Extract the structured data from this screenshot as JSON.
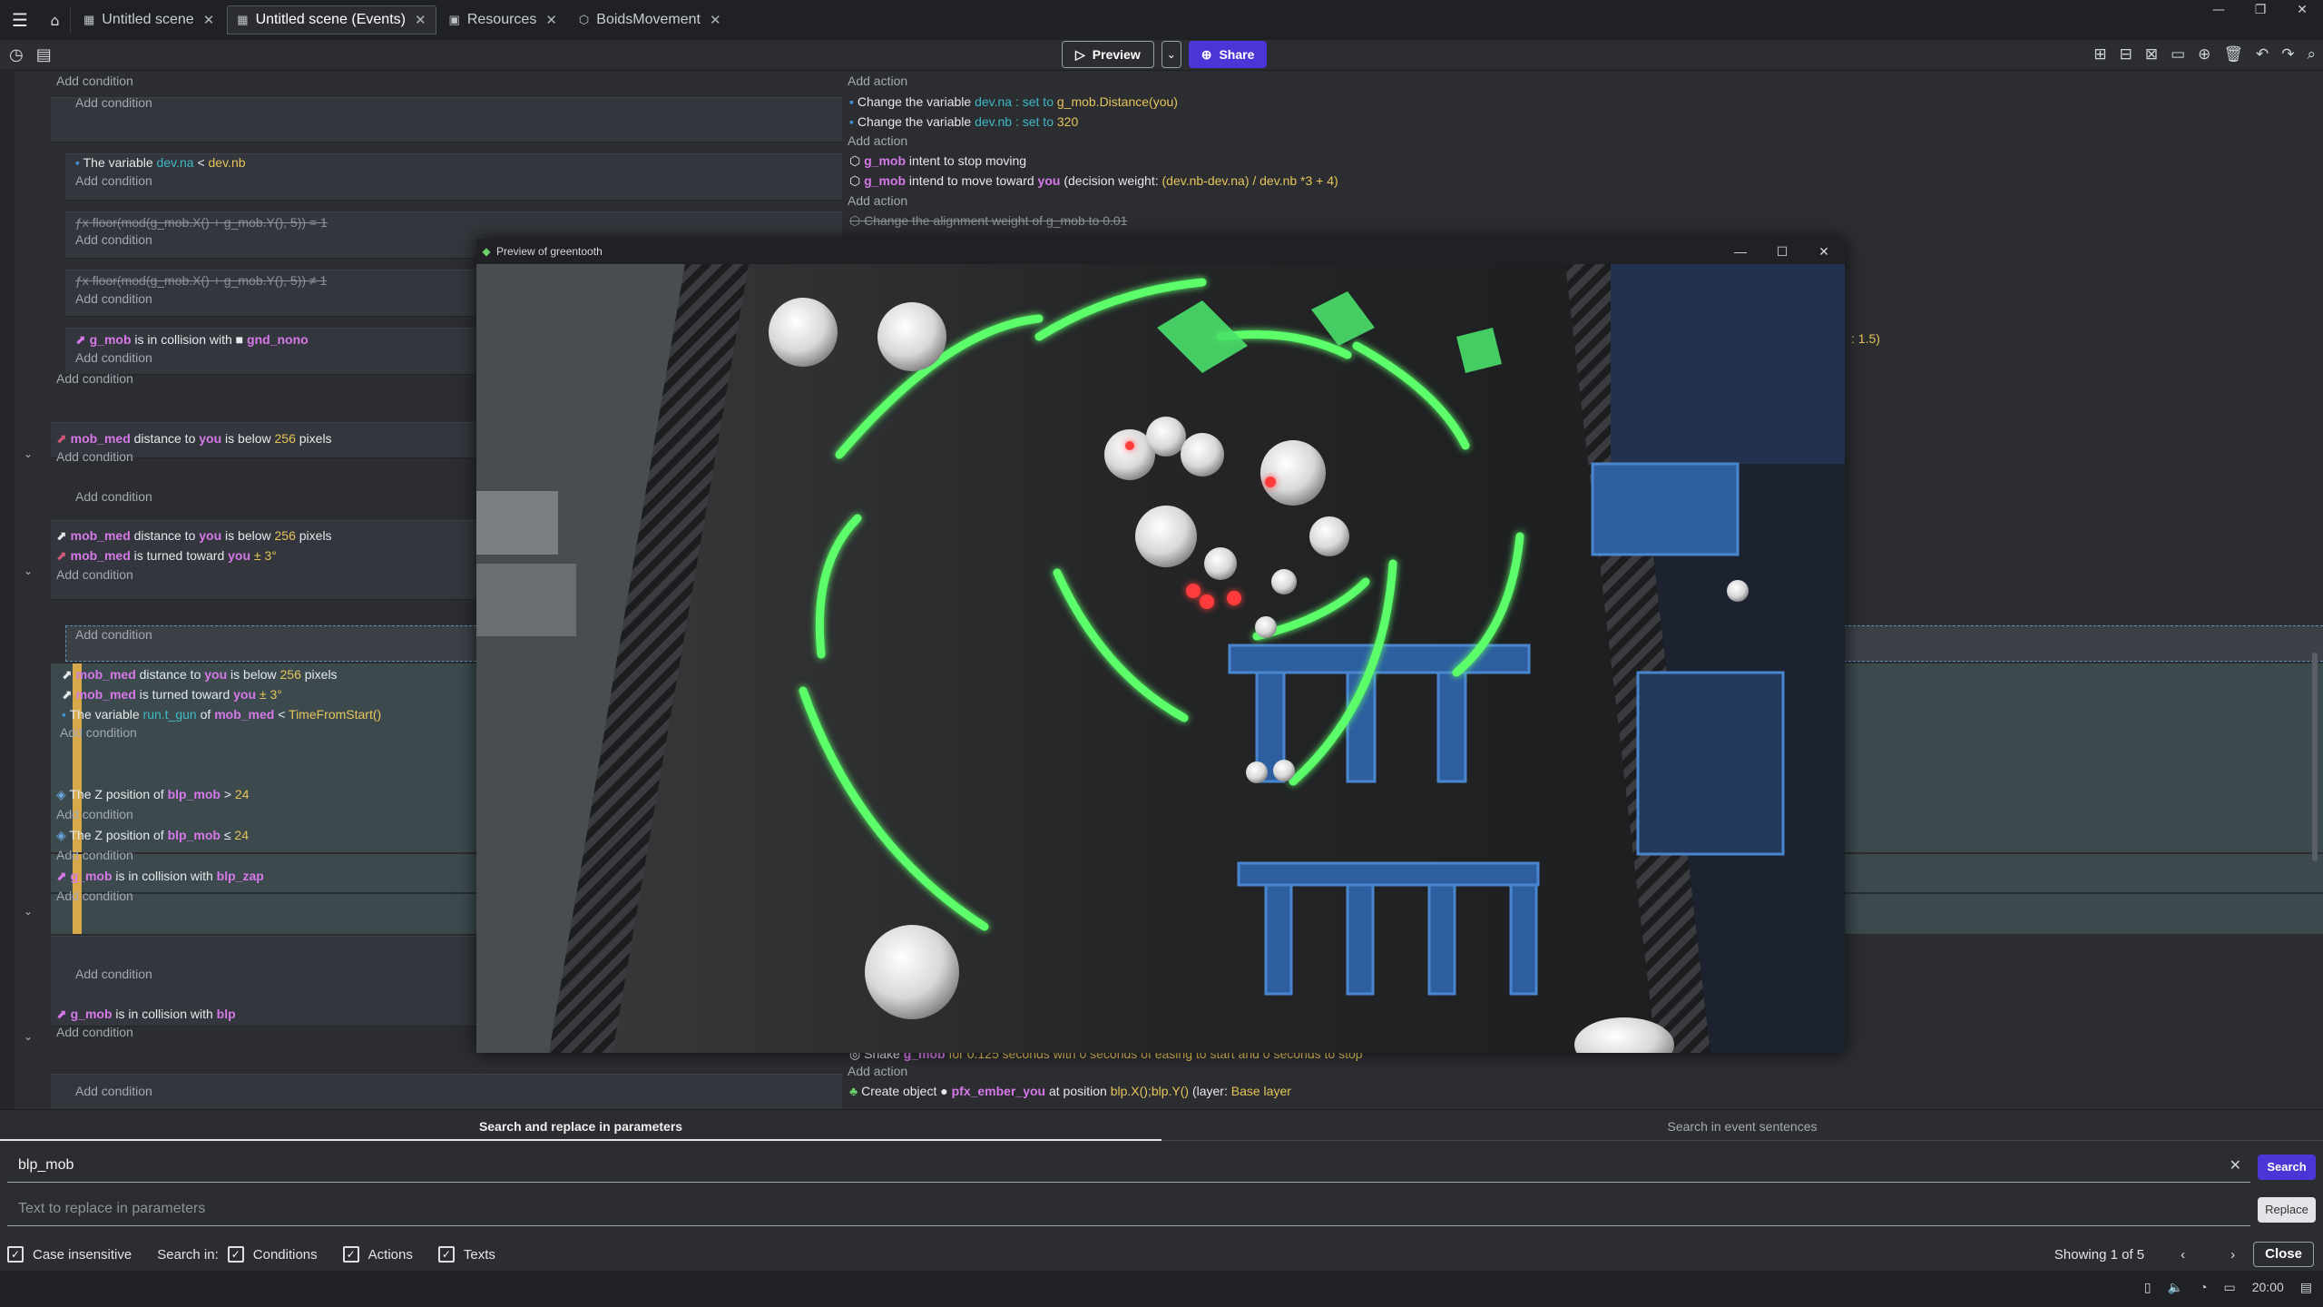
{
  "tabs": [
    {
      "label": "Untitled scene",
      "icon": "▦"
    },
    {
      "label": "Untitled scene (Events)",
      "icon": "▦"
    },
    {
      "label": "Resources",
      "icon": "▣"
    },
    {
      "label": "BoidsMovement",
      "icon": "⬡"
    }
  ],
  "toolbar": {
    "preview_label": "Preview",
    "share_label": "Share"
  },
  "events": {
    "add_condition": "Add condition",
    "add_action": "Add action",
    "actions_top": {
      "set_dev_na_prefix": "Change the variable",
      "set_dev_na_var": "dev.na",
      "set_dev_na_mid": ": set to",
      "set_dev_na_val": "g_mob.Distance(you)",
      "set_dev_nb_prefix": "Change the variable",
      "set_dev_nb_var": "dev.nb",
      "set_dev_nb_mid": ": set to",
      "set_dev_nb_val": "320",
      "stop_obj": "g_mob",
      "stop_text": "intent to stop moving",
      "move_obj": "g_mob",
      "move_text": "intend to move toward",
      "move_target": "you",
      "move_weight_label": "(decision weight:",
      "move_weight_val": "(dev.nb-dev.na) / dev.nb *3 + 4)",
      "align_text": "Change the alignment weight of",
      "align_obj": "g_mob",
      "align_to": "to",
      "align_val": "0.01",
      "partial_right": ": 1.5)"
    },
    "conditions": {
      "var_na_text": "The variable",
      "var_na_var": "dev.na",
      "var_na_op": "<",
      "var_na_val": "dev.nb",
      "floor1": "floor(mod(g_mob.X() + g_mob.Y(), 5)) = 1",
      "floor2": "floor(mod(g_mob.X() + g_mob.Y(), 5)) ≠ 1",
      "coll_nono_obj": "g_mob",
      "coll_nono_text": "is in collision with",
      "coll_nono_target": "gnd_nono",
      "dist1_obj": "mob_med",
      "dist1_text": "distance to",
      "dist1_target": "you",
      "dist1_below": "is below",
      "dist1_val": "256",
      "dist1_unit": "pixels",
      "dist2_obj": "mob_med",
      "dist2_text": "distance to",
      "dist2_target": "you",
      "dist2_below": "is below",
      "dist2_val": "256",
      "dist2_unit": "pixels",
      "turn2_obj": "mob_med",
      "turn2_text": "is turned toward",
      "turn2_target": "you",
      "turn2_val": "± 3°",
      "dist3_obj": "mob_med",
      "dist3_text": "distance to",
      "dist3_target": "you",
      "dist3_below": "is below",
      "dist3_val": "256",
      "dist3_unit": "pixels",
      "turn3_obj": "mob_med",
      "turn3_text": "is turned toward",
      "turn3_target": "you",
      "turn3_val": "± 3°",
      "gunvar_text": "The variable",
      "gunvar_var": "run.t_gun",
      "gunvar_of": "of",
      "gunvar_obj": "mob_med",
      "gunvar_op": "<",
      "gunvar_val": "TimeFromStart()",
      "z1_text": "The Z position of",
      "z1_obj": "blp_mob",
      "z1_op": ">",
      "z1_val": "24",
      "z2_text": "The Z position of",
      "z2_obj": "blp_mob",
      "z2_op": "≤",
      "z2_val": "24",
      "coll_zap_obj": "g_mob",
      "coll_zap_text": "is in collision with",
      "coll_zap_target": "blp_zap",
      "coll_blp_obj": "g_mob",
      "coll_blp_text": "is in collision with",
      "coll_blp_target": "blp"
    },
    "actions_bottom": {
      "shake_text": "Shake",
      "shake_obj": "g_mob",
      "shake_rest": "for 0.125 seconds with 0 seconds of easing to start and 0 seconds to stop",
      "create_text": "Create object",
      "create_obj": "pfx_ember_you",
      "create_at": "at position",
      "create_pos": "blp.X();blp.Y()",
      "create_layer_label": "(layer:",
      "create_layer": "Base layer"
    }
  },
  "preview_window": {
    "title": "Preview of greentooth"
  },
  "search_panel": {
    "tab_params": "Search and replace in parameters",
    "tab_sentences": "Search in event sentences",
    "search_value": "blp_mob",
    "replace_placeholder": "Text to replace in parameters",
    "search_button": "Search",
    "replace_button": "Replace",
    "case_insensitive": "Case insensitive",
    "search_in": "Search in:",
    "conditions": "Conditions",
    "actions": "Actions",
    "texts": "Texts",
    "showing": "Showing 1 of 5",
    "close_button": "Close"
  },
  "taskbar": {
    "clock": "20:00"
  },
  "colors": {
    "accent": "#4c35d6",
    "object": "#d679e8",
    "variable": "#3fb9c5",
    "value": "#e6c45a",
    "glow": "#5cff6a"
  }
}
